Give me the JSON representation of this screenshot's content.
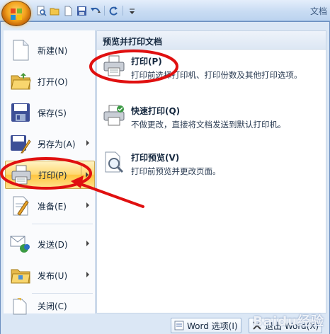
{
  "title_bar": {
    "text": "文档"
  },
  "quick_access": {
    "icons": [
      "print-preview-icon",
      "open-icon",
      "new-icon",
      "save-icon",
      "undo-icon",
      "redo-icon",
      "customize-icon"
    ]
  },
  "menu": {
    "items": [
      {
        "label": "新建(N)",
        "has_submenu": false
      },
      {
        "label": "打开(O)",
        "has_submenu": false
      },
      {
        "label": "保存(S)",
        "has_submenu": false
      },
      {
        "label": "另存为(A)",
        "has_submenu": true
      },
      {
        "label": "打印(P)",
        "has_submenu": true,
        "active": true
      },
      {
        "label": "准备(E)",
        "has_submenu": true
      },
      {
        "label": "发送(D)",
        "has_submenu": true
      },
      {
        "label": "发布(U)",
        "has_submenu": true
      },
      {
        "label": "关闭(C)",
        "has_submenu": false
      }
    ]
  },
  "submenu": {
    "header": "预览并打印文档",
    "options": [
      {
        "title": "打印(P)",
        "desc": "打印前选择打印机、打印份数及其他打印选项。"
      },
      {
        "title": "快速打印(Q)",
        "desc": "不做更改，直接将文档发送到默认打印机。"
      },
      {
        "title": "打印预览(V)",
        "desc": "打印前预览并更改页面。"
      }
    ]
  },
  "footer": {
    "options_label": "Word 选项(I)",
    "exit_label": "退出 Word(X)"
  },
  "watermark": "Baidu经验",
  "colors": {
    "highlight": "#ffc53f",
    "annotation": "#e01010"
  }
}
